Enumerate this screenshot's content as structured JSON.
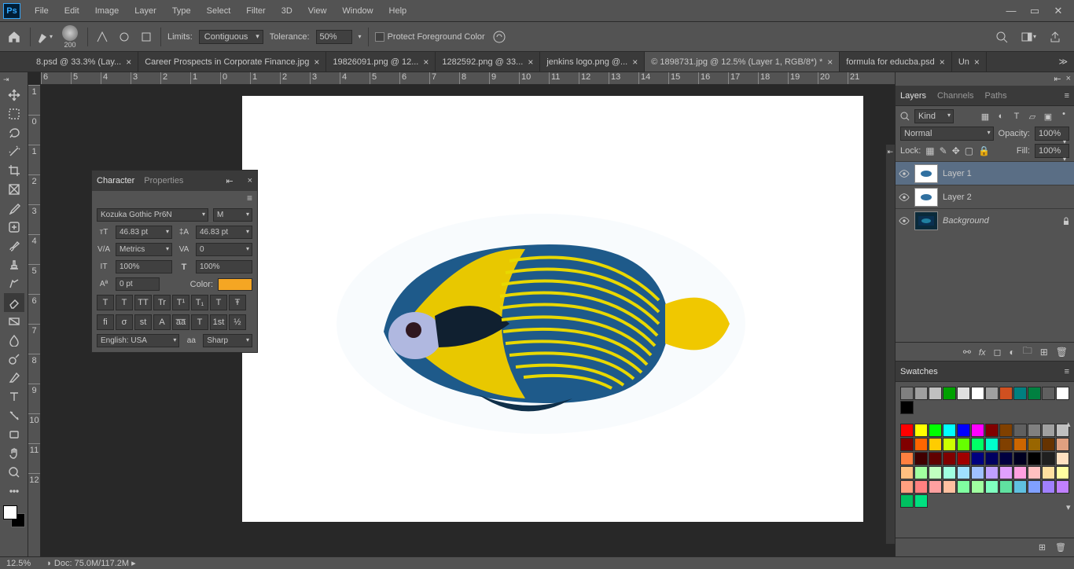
{
  "menubar": {
    "items": [
      "File",
      "Edit",
      "Image",
      "Layer",
      "Type",
      "Select",
      "Filter",
      "3D",
      "View",
      "Window",
      "Help"
    ]
  },
  "optionsbar": {
    "brush_size": "200",
    "limits_label": "Limits:",
    "limits_value": "Contiguous",
    "tolerance_label": "Tolerance:",
    "tolerance_value": "50%",
    "protect_fg": "Protect Foreground Color"
  },
  "tabs": [
    {
      "label": "8.psd @ 33.3% (Lay...",
      "active": false
    },
    {
      "label": "Career Prospects in Corporate Finance.jpg",
      "active": false
    },
    {
      "label": "19826091.png @ 12...",
      "active": false
    },
    {
      "label": "1282592.png @ 33...",
      "active": false
    },
    {
      "label": "jenkins logo.png @...",
      "active": false
    },
    {
      "label": "© 1898731.jpg @ 12.5% (Layer 1, RGB/8*) *",
      "active": true
    },
    {
      "label": "formula for educba.psd",
      "active": false
    },
    {
      "label": "Un",
      "active": false
    }
  ],
  "ruler_h": [
    "6",
    "5",
    "4",
    "3",
    "2",
    "1",
    "0",
    "1",
    "2",
    "3",
    "4",
    "5",
    "6",
    "7",
    "8",
    "9",
    "10",
    "11",
    "12",
    "13",
    "14",
    "15",
    "16",
    "17",
    "18",
    "19",
    "20",
    "21"
  ],
  "ruler_v": [
    "1",
    "0",
    "1",
    "2",
    "3",
    "4",
    "5",
    "6",
    "7",
    "8",
    "9",
    "10",
    "11",
    "12"
  ],
  "char_panel": {
    "tab1": "Character",
    "tab2": "Properties",
    "font": "Kozuka Gothic Pr6N",
    "style": "M",
    "size": "46.83 pt",
    "leading": "46.83 pt",
    "kerning": "Metrics",
    "tracking": "0",
    "vscale": "100%",
    "hscale": "100%",
    "baseline": "0 pt",
    "color_label": "Color:",
    "lang": "English: USA",
    "aa": "Sharp",
    "styles": [
      "T",
      "T",
      "TT",
      "Tr",
      "T¹",
      "T₁",
      "T",
      "Ŧ"
    ],
    "ot": [
      "fi",
      "σ",
      "st",
      "A",
      "a̅a̅",
      "T",
      "1st",
      "½"
    ]
  },
  "layers_panel": {
    "tabs": [
      "Layers",
      "Channels",
      "Paths"
    ],
    "kind_label": "Kind",
    "blend": "Normal",
    "opacity_label": "Opacity:",
    "opacity": "100%",
    "lock_label": "Lock:",
    "fill_label": "Fill:",
    "fill": "100%",
    "layers": [
      {
        "name": "Layer 1",
        "selected": true,
        "locked": false,
        "bg": "white"
      },
      {
        "name": "Layer 2",
        "selected": false,
        "locked": false,
        "bg": "white"
      },
      {
        "name": "Background",
        "selected": false,
        "locked": true,
        "bg": "dark"
      }
    ]
  },
  "swatches": {
    "title": "Swatches",
    "row1": [
      "#808080",
      "#a0a0a0",
      "#c0c0c0",
      "#00a000",
      "#e0e0e0",
      "#ffffff",
      "#a0a0a0",
      "#d05020",
      "#008080",
      "#008040",
      "#606060",
      "#ffffff",
      "#000000"
    ],
    "colors": [
      "#ff0000",
      "#ffff00",
      "#00ff00",
      "#00ffff",
      "#0000ff",
      "#ff00ff",
      "#800000",
      "#804000",
      "#606060",
      "#808080",
      "#a0a0a0",
      "#c0c0c0",
      "#800000",
      "#ff6600",
      "#ffcc00",
      "#ccff00",
      "#66ff00",
      "#00ff66",
      "#00ffcc",
      "#804000",
      "#cc6600",
      "#996600",
      "#663300",
      "#e0a080",
      "#ff8040",
      "#400000",
      "#600000",
      "#800000",
      "#a00000",
      "#000080",
      "#000060",
      "#000040",
      "#000020",
      "#000000",
      "#202020",
      "#ffe0c0",
      "#ffc080",
      "#a0ffa0",
      "#c0ffc0",
      "#a0ffe0",
      "#a0e0ff",
      "#a0c0ff",
      "#c0a0ff",
      "#e0a0ff",
      "#ffa0e0",
      "#ffc0c0",
      "#ffe0a0",
      "#ffffa0",
      "#ffa080",
      "#ff8080",
      "#ffa0a0",
      "#ffc0a0",
      "#80ffa0",
      "#a0ffa0",
      "#80ffc0",
      "#60e0a0",
      "#60c0e0",
      "#80a0ff",
      "#a080ff",
      "#c080ff",
      "#00c060",
      "#00e080"
    ]
  },
  "status": {
    "zoom": "12.5%",
    "doc": "Doc: 75.0M/117.2M"
  },
  "tools": [
    "move",
    "marquee",
    "lasso",
    "wand",
    "crop",
    "frame",
    "eyedrop",
    "heal",
    "brush",
    "stamp",
    "history",
    "eraser",
    "gradient",
    "blur",
    "dodge",
    "pen",
    "type",
    "path",
    "rect",
    "hand",
    "zoom",
    "more"
  ]
}
